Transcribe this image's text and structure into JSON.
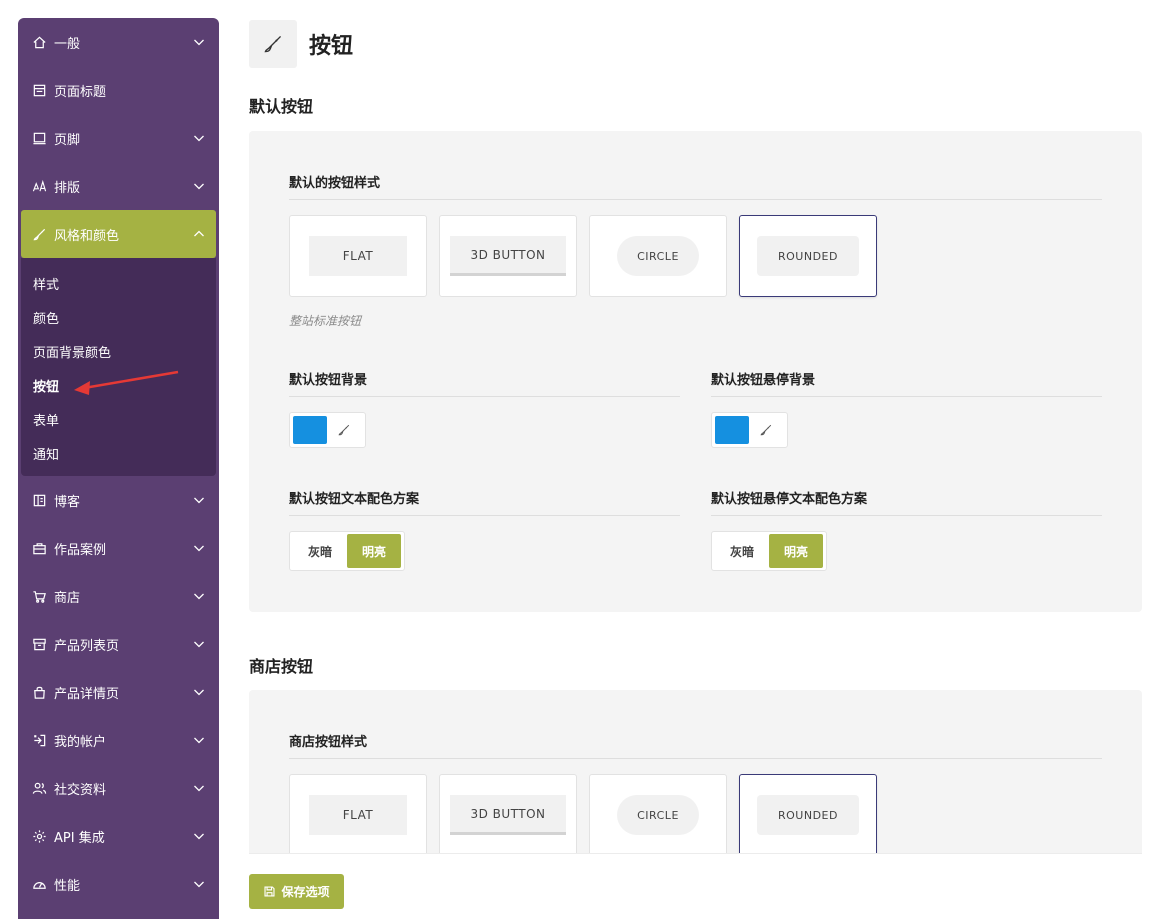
{
  "sidebar": {
    "items_top": [
      {
        "label": "一般",
        "icon": "home-icon",
        "has_chevron": true
      },
      {
        "label": "页面标题",
        "icon": "page-title-icon",
        "has_chevron": false
      },
      {
        "label": "页脚",
        "icon": "footer-icon",
        "has_chevron": true
      },
      {
        "label": "排版",
        "icon": "typography-icon",
        "has_chevron": true
      }
    ],
    "active_item": {
      "label": "风格和颜色",
      "icon": "brush-icon"
    },
    "submenu": [
      "样式",
      "颜色",
      "页面背景颜色",
      "按钮",
      "表单",
      "通知"
    ],
    "current_sub": "按钮",
    "items_bottom": [
      {
        "label": "博客",
        "icon": "blog-icon"
      },
      {
        "label": "作品案例",
        "icon": "portfolio-icon"
      },
      {
        "label": "商店",
        "icon": "cart-icon"
      },
      {
        "label": "产品列表页",
        "icon": "product-list-icon"
      },
      {
        "label": "产品详情页",
        "icon": "product-detail-icon"
      },
      {
        "label": "我的帐户",
        "icon": "account-icon"
      },
      {
        "label": "社交资料",
        "icon": "social-icon"
      },
      {
        "label": "API 集成",
        "icon": "gear-icon"
      },
      {
        "label": "性能",
        "icon": "gauge-icon"
      }
    ]
  },
  "page": {
    "title": "按钮",
    "icon": "brush-icon"
  },
  "default_section": {
    "title": "默认按钮",
    "style_label": "默认的按钮样式",
    "styles": [
      "FLAT",
      "3D BUTTON",
      "CIRCLE",
      "ROUNDED"
    ],
    "selected_style": "ROUNDED",
    "hint": "整站标准按钮",
    "bg_label": "默认按钮背景",
    "hover_bg_label": "默认按钮悬停背景",
    "bg_color": "#1590e0",
    "hover_bg_color": "#1590e0",
    "text_scheme_label": "默认按钮文本配色方案",
    "hover_text_scheme_label": "默认按钮悬停文本配色方案",
    "scheme_options": [
      "灰暗",
      "明亮"
    ],
    "scheme_selected": "明亮",
    "hover_scheme_selected": "明亮"
  },
  "shop_section": {
    "title": "商店按钮",
    "style_label": "商店按钮样式",
    "styles": [
      "FLAT",
      "3D BUTTON",
      "CIRCLE",
      "ROUNDED"
    ],
    "selected_style": "ROUNDED"
  },
  "save": {
    "label": "保存选项",
    "icon": "save-icon"
  },
  "colors": {
    "sidebar": "#5b3f72",
    "submenu": "#442c58",
    "accent": "#a5b243",
    "selected_border": "#3a3a78",
    "annotation_arrow": "#e53935"
  }
}
